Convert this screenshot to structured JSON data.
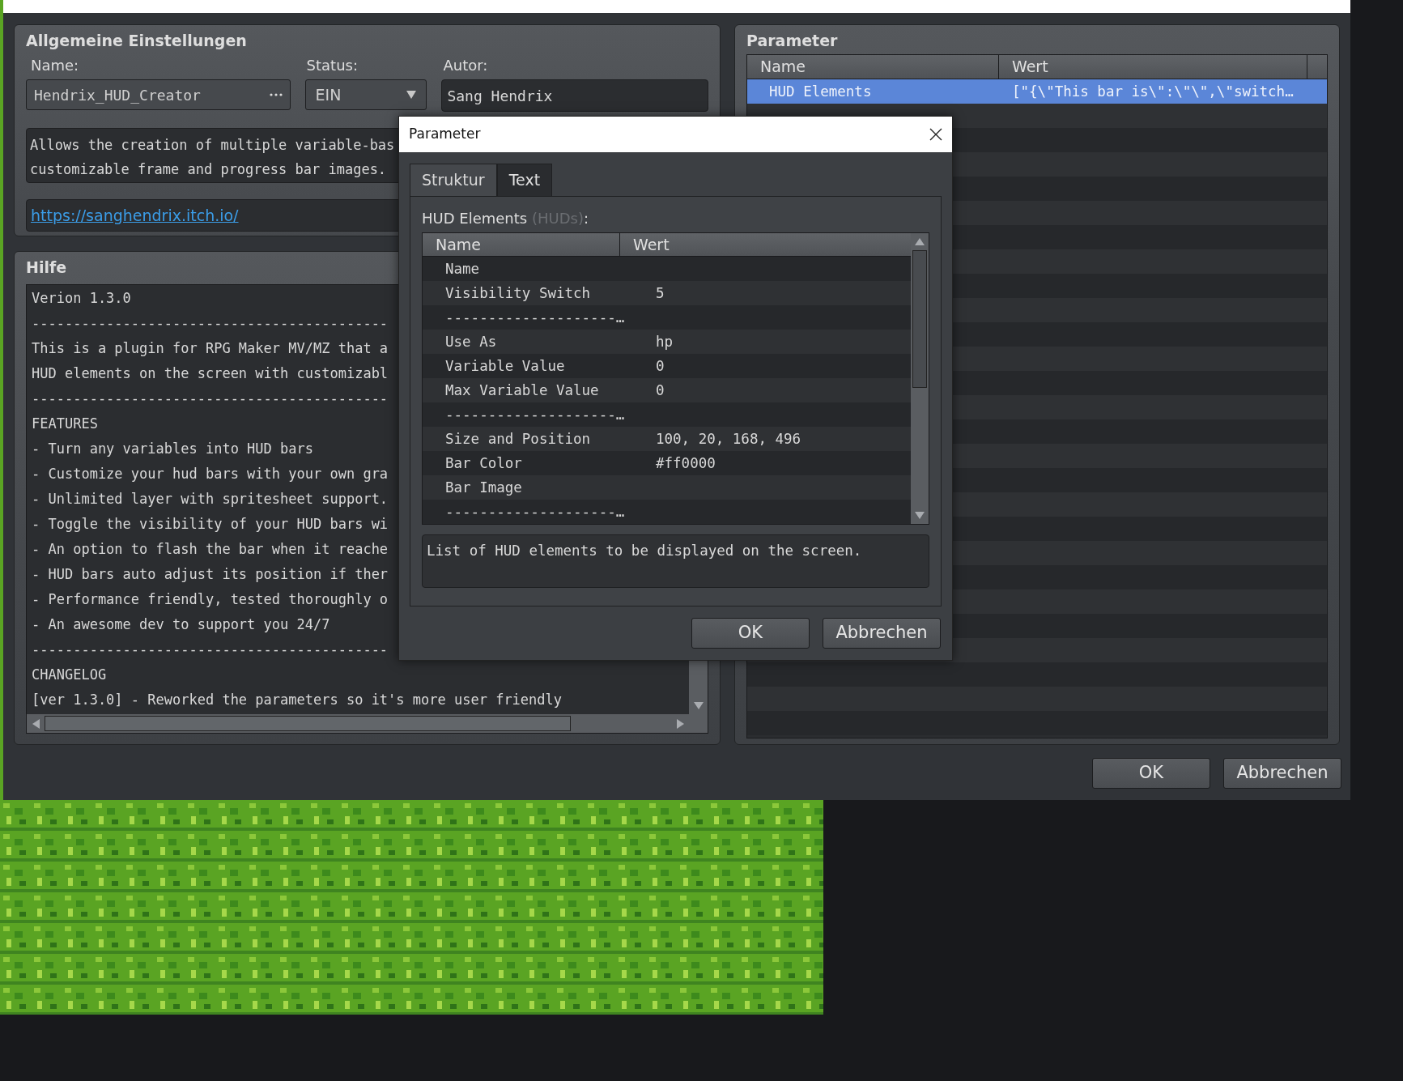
{
  "general": {
    "title": "Allgemeine Einstellungen",
    "name_label": "Name:",
    "name_value": "Hendrix_HUD_Creator",
    "status_label": "Status:",
    "status_value": "EIN",
    "author_label": "Autor:",
    "author_value": "Sang Hendrix",
    "description": [
      "Allows the creation of multiple variable-bas",
      "customizable frame and progress bar images."
    ],
    "url": "https://sanghendrix.itch.io/"
  },
  "help": {
    "title": "Hilfe",
    "lines": [
      "Verion 1.3.0",
      "-------------------------------------------",
      "This is a plugin for RPG Maker MV/MZ that a",
      "HUD elements on the screen with customizabl",
      "-------------------------------------------",
      "FEATURES",
      "- Turn any variables into HUD bars",
      "- Customize your hud bars with your own gra",
      "- Unlimited layer with spritesheet support.",
      "- Toggle the visibility of your HUD bars wi",
      "- An option to flash the bar when it reache",
      "- HUD bars auto adjust its position if ther",
      "- Performance friendly, tested thoroughly o",
      "- An awesome dev to support you 24/7",
      "-------------------------------------------",
      "CHANGELOG",
      "[ver 1.3.0] - Reworked the parameters so it's more user friendly"
    ]
  },
  "parameters": {
    "title": "Parameter",
    "columns": [
      "Name",
      "Wert"
    ],
    "rows": [
      {
        "name": "HUD Elements",
        "value": "[\"{\\\"This bar is\\\":\\\"\\\",\\\"switch…",
        "selected": true
      },
      {
        "selected": false
      }
    ]
  },
  "buttons": [
    "OK",
    "Abbrechen"
  ],
  "dialog": {
    "title": "Parameter",
    "tabs": [
      {
        "label": "Struktur",
        "selected": true
      },
      {
        "label": "Text",
        "selected": false
      }
    ],
    "field_label": "HUD Elements",
    "field_key": "(HUDs)",
    "field_suffix": ":",
    "columns": [
      "Name",
      "Wert"
    ],
    "rows": [
      {
        "name": "Name"
      },
      {
        "name": "Visibility Switch",
        "value": "5"
      },
      {
        "name": "--------------------…"
      },
      {
        "name": "Use As",
        "value": "hp"
      },
      {
        "name": "Variable Value",
        "value": "0"
      },
      {
        "name": "Max Variable Value",
        "value": "0"
      },
      {
        "name": "--------------------…"
      },
      {
        "name": "Size and Position",
        "value": "100, 20, 168, 496"
      },
      {
        "name": "Bar Color",
        "value": "#ff0000"
      },
      {
        "name": "Bar Image"
      },
      {
        "name": "--------------------…"
      }
    ],
    "description": "List of HUD elements to be displayed on the screen.",
    "buttons": [
      "OK",
      "Abbrechen"
    ]
  }
}
